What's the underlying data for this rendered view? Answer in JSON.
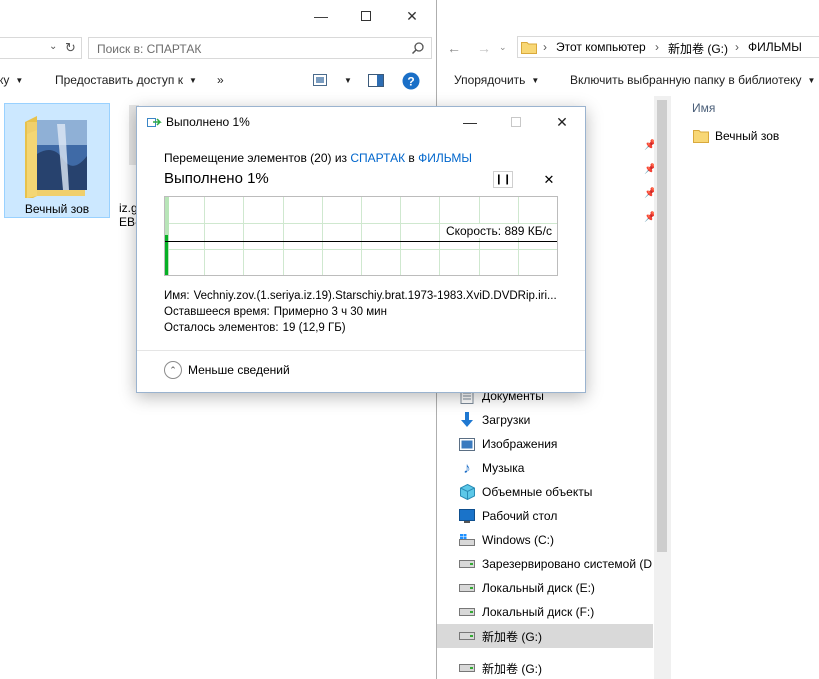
{
  "left_window": {
    "search_placeholder": "Поиск в: СПАРТАК",
    "cmd_partial": "ку",
    "cmd_share": "Предоставить доступ к",
    "cmd_more": "»",
    "tile_label": "Вечный зов",
    "tile2_label_line1": "iz.g",
    "tile2_label_line2": "EB-"
  },
  "right_window": {
    "breadcrumb": [
      "Этот компьютер",
      "新加卷 (G:)",
      "ФИЛЬМЫ"
    ],
    "cmd_organize": "Упорядочить",
    "cmd_include": "Включить выбранную папку в библиотеку",
    "column_name": "Имя",
    "content_items": [
      {
        "label": "Вечный зов"
      }
    ],
    "nav_items": [
      {
        "label": "Документы"
      },
      {
        "label": "Загрузки"
      },
      {
        "label": "Изображения"
      },
      {
        "label": "Музыка"
      },
      {
        "label": "Объемные объекты"
      },
      {
        "label": "Рабочий стол"
      },
      {
        "label": "Windows (C:)"
      },
      {
        "label": "Зарезервировано системой (D"
      },
      {
        "label": "Локальный диск (E:)"
      },
      {
        "label": "Локальный диск (F:)"
      },
      {
        "label": "新加卷 (G:)"
      },
      {
        "label": "新加卷 (G:)"
      }
    ]
  },
  "dialog": {
    "title": "Выполнено 1%",
    "move_prefix": "Перемещение элементов (20) из",
    "source": "СПАРТАК",
    "in_word": "в",
    "destination": "ФИЛЬМЫ",
    "heading": "Выполнено 1%",
    "progress_percent": 1,
    "speed": "Скорость: 889 КБ/с",
    "name_label": "Имя:",
    "name_value": "Vechniy.zov.(1.seriya.iz.19).Starschiy.brat.1973-1983.XviD.DVDRip.iri...",
    "time_label": "Оставшееся время:",
    "time_value": "Примерно 3 ч 30 мин",
    "items_label": "Осталось элементов:",
    "items_value": "19 (12,9 ГБ)",
    "less_details": "Меньше сведений"
  },
  "colors": {
    "accent": "#0066cc",
    "progress_green": "#06b025",
    "graph_fill": "#b8e5b8",
    "selection": "#cce8ff"
  }
}
